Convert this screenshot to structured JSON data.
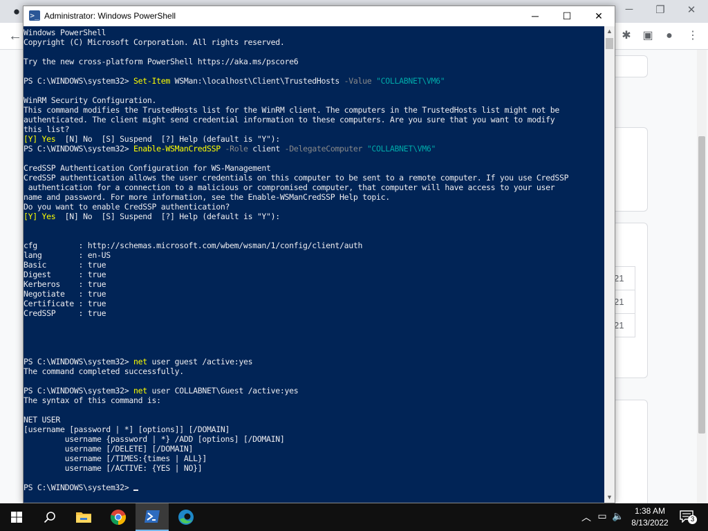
{
  "powershell": {
    "title": "Administrator: Windows PowerShell",
    "icon": "powershell-icon",
    "controls": {
      "minimize": "─",
      "maximize": "☐",
      "close": "✕"
    },
    "lines": [
      [
        {
          "t": "Windows PowerShell"
        }
      ],
      [
        {
          "t": "Copyright (C) Microsoft Corporation. All rights reserved."
        }
      ],
      [],
      [
        {
          "t": "Try the new cross-platform PowerShell https://aka.ms/pscore6"
        }
      ],
      [],
      [
        {
          "t": "PS C:\\WINDOWS\\system32> "
        },
        {
          "t": "Set-Item",
          "c": "y"
        },
        {
          "t": " WSMan:\\localhost\\Client\\TrustedHosts "
        },
        {
          "t": "-Value",
          "c": "p"
        },
        {
          "t": " "
        },
        {
          "t": "\"COLLABNET\\VM6\"",
          "c": "s"
        }
      ],
      [],
      [
        {
          "t": "WinRM Security Configuration."
        }
      ],
      [
        {
          "t": "This command modifies the TrustedHosts list for the WinRM client. The computers in the TrustedHosts list might not be"
        }
      ],
      [
        {
          "t": "authenticated. The client might send credential information to these computers. Are you sure that you want to modify"
        }
      ],
      [
        {
          "t": "this list?"
        }
      ],
      [
        {
          "t": "[Y] Yes",
          "c": "y"
        },
        {
          "t": "  [N] No  [S] Suspend  [?] Help (default is \"Y\"):"
        }
      ],
      [
        {
          "t": "PS C:\\WINDOWS\\system32> "
        },
        {
          "t": "Enable-WSManCredSSP",
          "c": "y"
        },
        {
          "t": " "
        },
        {
          "t": "-Role",
          "c": "p"
        },
        {
          "t": " client "
        },
        {
          "t": "-DelegateComputer",
          "c": "p"
        },
        {
          "t": " "
        },
        {
          "t": "\"COLLABNET\\VM6\"",
          "c": "s"
        }
      ],
      [],
      [
        {
          "t": "CredSSP Authentication Configuration for WS-Management"
        }
      ],
      [
        {
          "t": "CredSSP authentication allows the user credentials on this computer to be sent to a remote computer. If you use CredSSP"
        }
      ],
      [
        {
          "t": " authentication for a connection to a malicious or compromised computer, that computer will have access to your user"
        }
      ],
      [
        {
          "t": "name and password. For more information, see the Enable-WSManCredSSP Help topic."
        }
      ],
      [
        {
          "t": "Do you want to enable CredSSP authentication?"
        }
      ],
      [
        {
          "t": "[Y] Yes",
          "c": "y"
        },
        {
          "t": "  [N] No  [S] Suspend  [?] Help (default is \"Y\"):"
        }
      ],
      [],
      [],
      [
        {
          "t": "cfg         : http://schemas.microsoft.com/wbem/wsman/1/config/client/auth"
        }
      ],
      [
        {
          "t": "lang        : en-US"
        }
      ],
      [
        {
          "t": "Basic       : true"
        }
      ],
      [
        {
          "t": "Digest      : true"
        }
      ],
      [
        {
          "t": "Kerberos    : true"
        }
      ],
      [
        {
          "t": "Negotiate   : true"
        }
      ],
      [
        {
          "t": "Certificate : true"
        }
      ],
      [
        {
          "t": "CredSSP     : true"
        }
      ],
      [],
      [],
      [],
      [],
      [
        {
          "t": "PS C:\\WINDOWS\\system32> "
        },
        {
          "t": "net",
          "c": "y"
        },
        {
          "t": " user guest /active:yes"
        }
      ],
      [
        {
          "t": "The command completed successfully."
        }
      ],
      [],
      [
        {
          "t": "PS C:\\WINDOWS\\system32> "
        },
        {
          "t": "net",
          "c": "y"
        },
        {
          "t": " user COLLABNET\\Guest /active:yes"
        }
      ],
      [
        {
          "t": "The syntax of this command is:"
        }
      ],
      [],
      [
        {
          "t": "NET USER"
        }
      ],
      [
        {
          "t": "[username [password | *] [options]] [/DOMAIN]"
        }
      ],
      [
        {
          "t": "         username {password | *} /ADD [options] [/DOMAIN]"
        }
      ],
      [
        {
          "t": "         username [/DELETE] [/DOMAIN]"
        }
      ],
      [
        {
          "t": "         username [/TIMES:{times | ALL}]"
        }
      ],
      [
        {
          "t": "         username [/ACTIVE: {YES | NO}]"
        }
      ],
      [],
      [
        {
          "t": "PS C:\\WINDOWS\\system32> "
        },
        {
          "t": "",
          "cursor": true
        }
      ]
    ]
  },
  "background": {
    "cells": [
      "21",
      "21",
      "21"
    ]
  },
  "taskbar": {
    "items": [
      {
        "name": "start-button",
        "icon": "windows-logo-icon"
      },
      {
        "name": "search-button",
        "icon": "search-icon"
      },
      {
        "name": "file-explorer-button",
        "icon": "folder-icon"
      },
      {
        "name": "chrome-button",
        "icon": "chrome-icon"
      },
      {
        "name": "powershell-button",
        "icon": "powershell-icon",
        "active": true
      },
      {
        "name": "edge-button",
        "icon": "edge-icon"
      }
    ],
    "clock": {
      "time": "1:38 AM",
      "date": "8/13/2022"
    },
    "notifications": "3"
  },
  "colors": {
    "console_bg": "#012456",
    "console_fg": "#eeedf0",
    "command": "#ffff00",
    "parameter": "#8a8a8a",
    "string": "#00aaaa",
    "taskbar": "#101010"
  }
}
